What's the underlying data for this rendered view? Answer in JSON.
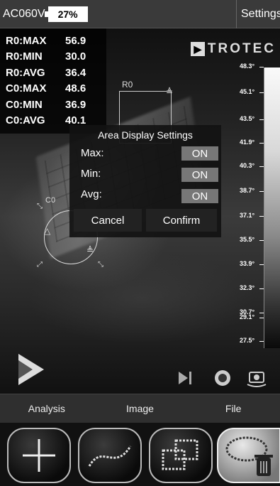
{
  "header": {
    "model": "AC060V",
    "battery": "27%",
    "settings_tab": "Settings"
  },
  "stats": [
    {
      "label": "R0:MAX",
      "value": "56.9"
    },
    {
      "label": "R0:MIN",
      "value": "30.0"
    },
    {
      "label": "R0:AVG",
      "value": "36.4"
    },
    {
      "label": "C0:MAX",
      "value": "48.6"
    },
    {
      "label": "C0:MIN",
      "value": "36.9"
    },
    {
      "label": "C0:AVG",
      "value": "40.1"
    }
  ],
  "logo": {
    "mark": "▶",
    "text": "TROTEC"
  },
  "scale": [
    "48.3°",
    "45.1°",
    "43.5°",
    "41.9°",
    "40.3°",
    "38.7°",
    "37.1°",
    "35.5°",
    "33.9°",
    "32.3°",
    "30.7°",
    "29.1°",
    "27.5°"
  ],
  "roi": {
    "rect_label": "R0",
    "circle_label": "C0"
  },
  "dialog": {
    "title": "Area Display Settings",
    "rows": [
      {
        "label": "Max:",
        "state": "ON"
      },
      {
        "label": "Min:",
        "state": "ON"
      },
      {
        "label": "Avg:",
        "state": "ON"
      }
    ],
    "cancel": "Cancel",
    "confirm": "Confirm"
  },
  "tabs": [
    "Analysis",
    "Image",
    "File"
  ],
  "tools": [
    "crosshair-tool-icon",
    "line-tool-icon",
    "rectangle-tool-icon",
    "circle-delete-tool-icon"
  ]
}
